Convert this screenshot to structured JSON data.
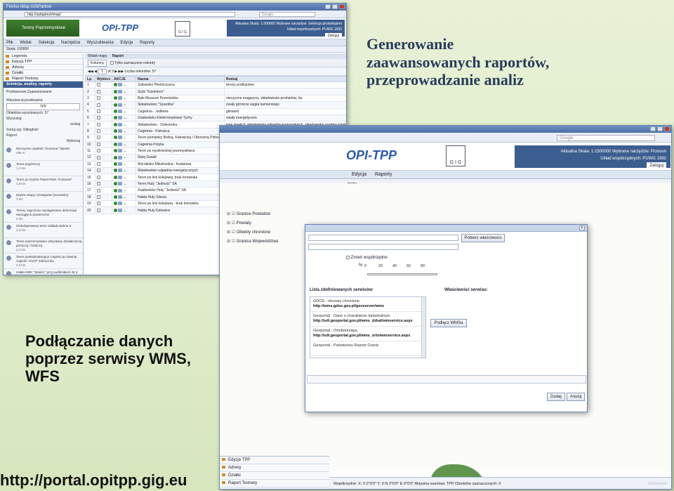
{
  "headings": {
    "top_line1": "Generowanie",
    "top_line2": "zaawansowanych raportów, przeprowadzanie analiz",
    "mid": "Podłączanie danych poprzez serwisy WMS, WFS",
    "footer_url": "http://portal.opitpp.gig.eu"
  },
  "win1": {
    "title": "Firefox  iMap GISPartner",
    "url": "http://opitpptest/imap/",
    "search_placeholder": "Google",
    "user_tile": "Tereny Poprzemysłowe",
    "logo": "OPI-TPP",
    "gig": "G I G",
    "status_line1": "Aktualna Skala: 1:300000  Wybrane narzędzie: Selekcja prostokątem",
    "status_line2": "Układ współrzędnych: PUWG 1992",
    "logout": "Zaloguj",
    "menu": [
      "Plik",
      "Widok",
      "Selekcja",
      "Narzędzia",
      "Wyszukiwania",
      "Edycja",
      "Raporty"
    ],
    "scale_label": "Skala: 100000",
    "left_items": [
      "Legenda",
      "Edycja TPP",
      "Adresy",
      "Działki",
      "Raport Testowy"
    ],
    "left_header": "Selekcja, analizy, raporty",
    "left_tabs": "Podstawowe   Zaawansowane",
    "form_lines": [
      "Warstwa wyszukiwania:",
      "TPP",
      "Obiektów wyszukanych: 57",
      "Wyszukaj:",
      "szukaj",
      "Sortuj wg: Odległość",
      "Raport",
      "Wykonaj"
    ],
    "results": [
      {
        "text": "Nieczynne osadniki \"Zuzanna\" Ślęskie",
        "dist": "499 m"
      },
      {
        "text": "Teren pogórniczy",
        "dist": "1,2 km"
      },
      {
        "text": "Teren po Szybie Paweł RWK \"Katowice\"",
        "dist": "1,8 km"
      },
      {
        "text": "Dawne skupy rozwagowe (torowisko)",
        "dist": "2 km"
      },
      {
        "text": "Tereny zagrożone wystąpieniem deformacji nieciągłych powierzchni",
        "dist": "2 km"
      },
      {
        "text": "Zrekultywowany teren zakładu Bolina II.",
        "dist": "2,3 km"
      },
      {
        "text": "Teren poprzemysłowo odzyskany działalnością górniczą i hutniczą",
        "dist": "2,4 km"
      },
      {
        "text": "Teren poeksploatacyjny Cegielni po dawnej cegielni \"Józef\" Kłobuczów",
        "dist": "2,9 km"
      },
      {
        "text": "Hałda KWK \"Staszic\" przy poddziałach 45 n skupy kolejowych",
        "dist": "3,2 km"
      }
    ],
    "grid_tabs": [
      "Widok mapy",
      "Raport"
    ],
    "columns_btn": "Kolumny",
    "only_selected": "Tylko zaznaczone rekordy",
    "page": "1",
    "of_pages": "of 3",
    "record_count": "Liczba rekordów: 57",
    "headers": [
      "Lp.",
      "Wybierz",
      "AKCJE",
      "Nazwa",
      "Rodzaj"
    ],
    "rows": [
      [
        "1",
        "Zalewisko Pleśniczyzna",
        "tereny podtopione"
      ],
      [
        "2",
        "Szyb \"Kazimierz\"",
        ""
      ],
      [
        "3",
        "Byłe Muzeum Przemiotów",
        "nieczynne magazyny, składowiska produktów, itp."
      ],
      [
        "4",
        "Składowisko \"Szarotka\"",
        "zwały górnicze węgla kamiennego"
      ],
      [
        "5",
        "Cegielnia - Jodłowa",
        "glinianki"
      ],
      [
        "6",
        "Zwałowisko Elektrociepłowni Tychy",
        "zwały energetyczne"
      ],
      [
        "7",
        "Składowisko - Dolerzonia",
        "inne zwały tj. składowiska odpadów komunalnych, składowiska osadów ściekowych"
      ],
      [
        "8",
        "Cegielnia - Pukowca",
        "glinianki"
      ],
      [
        "9",
        "Teren pomiędzy Boliną, Katowicką i Obrzeżną Północną",
        "nieużytki trawiaste i trawiasto-krzaczaste"
      ],
      [
        "10",
        "Cegielnia Potyka",
        "glinianki"
      ],
      [
        "11",
        "Teren po mysłowickiej przemysłówce",
        ""
      ],
      [
        "12",
        "Stary Ewald",
        "inne zwały tj. składowiska odpadów komunalnych, składowiska osadów ściekowych"
      ],
      [
        "13",
        "Wyrobisko Mikołowska - Kwiatowa",
        "glinianki"
      ],
      [
        "14",
        "Składowisko odpadów energetycznych",
        "zwały energetyczne"
      ],
      [
        "15",
        "Teren po linii kolejowej, brak torowiska",
        "nieczynne place, linie i węzły kolejowo-drogowe"
      ],
      [
        "16",
        "Teren Huty \"Jedność\" SA",
        "nieczynne magazyny, składowiska produktów, itp."
      ],
      [
        "17",
        "Zwałowisko Huty \"Jedność\" SA",
        "zwały przemysłu hutnictwa żelaza"
      ],
      [
        "18",
        "Hałda Huty Silesia",
        "zwały hutnictwa metali nieżelaznych"
      ],
      [
        "19",
        "Teren po linii kolejowej - brak torowiska",
        "nieczynne place, linie i węzły kolejowo-drogowe"
      ],
      [
        "20",
        "Hałda Huty Katowice",
        "zwały przemysłu hutnictwa żelaza"
      ]
    ]
  },
  "win2": {
    "search_placeholder": "Google",
    "logo": "OPI-TPP",
    "gig": "G I G",
    "status_line1": "Aktualna Skala: 1:1500000  Wybrane narzędzie: Przesun",
    "status_line2": "Układ współrzędnych: PUWG 1992",
    "logout": "Zaloguj",
    "menu": [
      "Edycja",
      "Raporty"
    ],
    "tab": "mapy",
    "tree": [
      "Granice Powiatów",
      "Powiaty",
      "Obiekty chronione",
      "Granica Województwa"
    ],
    "lower_items": [
      "Edycja TPP",
      "Adresy",
      "Działki",
      "Raport Testowy"
    ],
    "status_bottom": "Współrzędne: X: 0 0°0'0\" Y: 0 N 0°0'0\" E 0°0'0\"  Aktywna warstwa: TPP  Obiektów zaznaczonych: 0",
    "watermark": "GISPartner"
  },
  "dialog": {
    "get_props_btn": "Pobierz właściwości",
    "change_coords": "Zmień współrzędne",
    "percent": "%",
    "ticks": [
      "0",
      "20",
      "40",
      "60",
      "80",
      "100"
    ],
    "list_label": "Lista zdefiniowanych serwisów:",
    "props_label": "Właściwości serwisu:",
    "services": [
      {
        "name": "GDOS - obszary chronione",
        "url": "http://wms.gdos.gov.pl/geoserver/wms"
      },
      {
        "name": "Geoportal - Dane o charakterze katastralnym",
        "url": "http://sdi.geoportal.gov.pl/wms_dzkat/wmservice.aspx"
      },
      {
        "name": "Geoportal - Ortofotomapa",
        "url": "http://sdi.geoportal.gov.pl/wms_orto/wmservice.aspx"
      },
      {
        "name": "Geoportal - Państwowy Rejestr Granic",
        "url": ""
      }
    ],
    "connect_btn": "Podłącz WMSa",
    "add_btn": "Dodaj",
    "cancel_btn": "Anuluj"
  }
}
